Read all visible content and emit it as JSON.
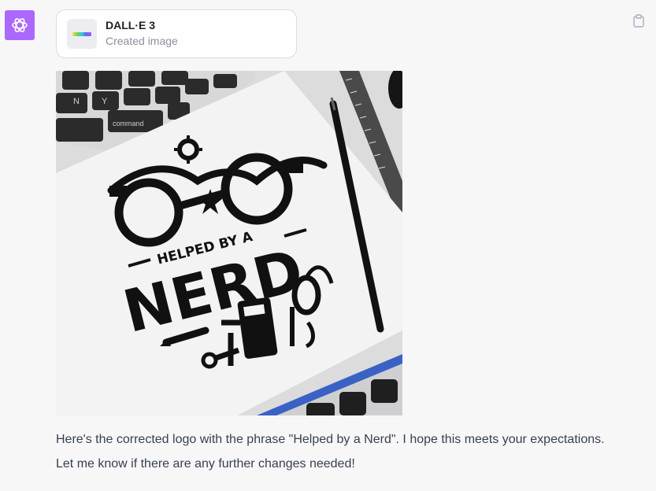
{
  "assistant": {
    "avatar_icon": "openai-logo-icon",
    "avatar_color": "#ab68ff"
  },
  "tool_call": {
    "name": "DALL·E 3",
    "status": "Created image",
    "thumb_icon": "dalle-color-bar-icon"
  },
  "image": {
    "alt": "Generated logo image",
    "logo_top_text": "HELPED BY A",
    "logo_main_text": "NERD",
    "keyboard_keys": [
      "N",
      "Y",
      "command"
    ]
  },
  "message": {
    "text": "Here's the corrected logo with the phrase \"Helped by a Nerd\". I hope this meets your expectations. Let me know if there are any further changes needed!"
  },
  "actions": {
    "copy_icon": "clipboard-icon"
  }
}
